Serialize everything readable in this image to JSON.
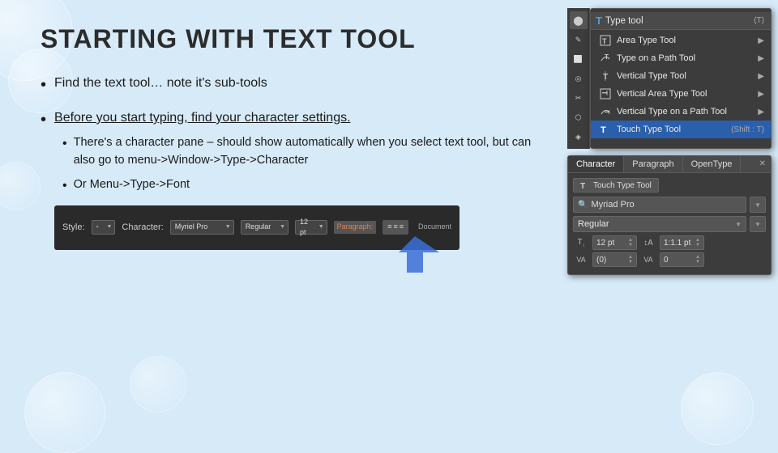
{
  "page": {
    "title": "STARTING WITH TEXT TOOL",
    "background_color": "#d6eaf8"
  },
  "bullets": [
    {
      "text": "Find the text tool… note it's sub-tools",
      "sub": []
    },
    {
      "text": "Before you start typing, find your character settings.",
      "underline": true,
      "sub": [
        "There's a character pane – should show automatically when you select text tool, but can also go to menu->Window->Type->Character",
        "Or Menu->Type->Font"
      ]
    }
  ],
  "toolbar_popup": {
    "header_item": "Type tool",
    "header_shortcut": "(T)",
    "items": [
      {
        "icon": "T",
        "label": "Area Type Tool",
        "shortcut": "",
        "arrow": true
      },
      {
        "icon": "⤵",
        "label": "Type on a Path Tool",
        "shortcut": "",
        "arrow": true
      },
      {
        "icon": "T",
        "label": "Vertical Type Tool",
        "shortcut": "",
        "arrow": true
      },
      {
        "icon": "T",
        "label": "Vertical Area Type Tool",
        "shortcut": "",
        "arrow": true
      },
      {
        "icon": "⤵",
        "label": "Vertical Type on a Path Tool",
        "shortcut": "",
        "arrow": true
      },
      {
        "icon": "T",
        "label": "Touch Type Tool",
        "shortcut": "(Shift : T)",
        "arrow": false
      }
    ]
  },
  "char_panel": {
    "tabs": [
      "Character",
      "Paragraph",
      "OpenType"
    ],
    "touch_type_btn": "Touch Type Tool",
    "font_name": "Myriad Pro",
    "font_style": "Regular",
    "size": "12 pt",
    "kerning_label": "VA",
    "kerning_value": "(0)",
    "tracking_label": "VA",
    "tracking_value": "0",
    "leading_label": "1:1.1 pt"
  },
  "bottom_bar": {
    "style_label": "Style:",
    "character_label": "Character:",
    "font_value": "Myriel Pro",
    "style_value": "Regular",
    "size_value": "12 pt",
    "paragraph_label": "Paragraph:",
    "document_label": "Document"
  },
  "left_toolbar_icons": [
    "⬤",
    "✎",
    "⬜",
    "◎",
    "✂",
    "⬡",
    "◈"
  ]
}
